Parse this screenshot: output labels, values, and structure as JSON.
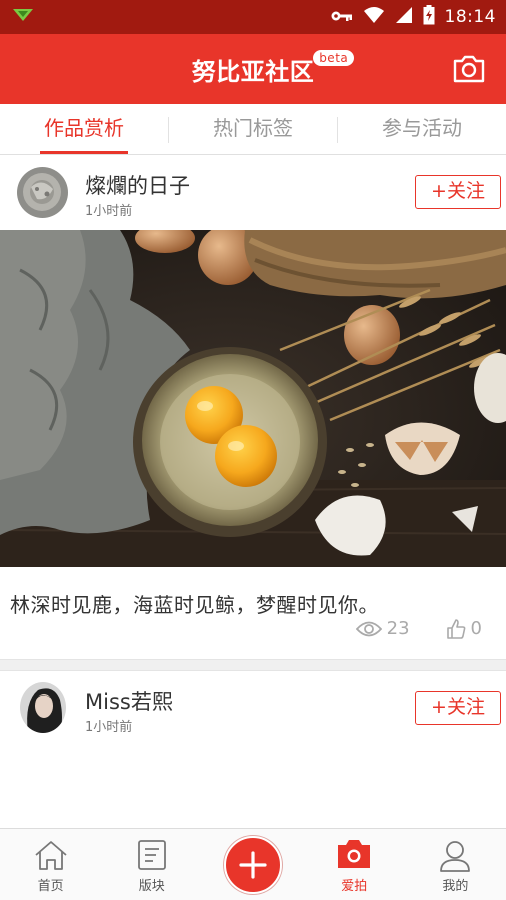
{
  "status_bar": {
    "time": "18:14"
  },
  "app_bar": {
    "title": "努比亚社区",
    "badge": "beta"
  },
  "tabs": [
    {
      "label": "作品赏析",
      "active": true
    },
    {
      "label": "热门标签",
      "active": false
    },
    {
      "label": "参与活动",
      "active": false
    }
  ],
  "posts": [
    {
      "author": "燦爛的日子",
      "time": "1小时前",
      "follow_label": "+关注",
      "caption": "林深时见鹿，海蓝时见鲸，梦醒时见你。",
      "views": "23",
      "likes": "0"
    },
    {
      "author": "Miss若熙",
      "time": "1小时前",
      "follow_label": "+关注"
    }
  ],
  "bottom_nav": {
    "items": [
      {
        "label": "首页",
        "icon": "home-icon"
      },
      {
        "label": "版块",
        "icon": "board-icon"
      },
      {
        "label": "",
        "icon": "plus-icon"
      },
      {
        "label": "爱拍",
        "icon": "camera-icon",
        "active": true
      },
      {
        "label": "我的",
        "icon": "profile-icon"
      }
    ]
  },
  "colors": {
    "accent": "#e8352a",
    "status_bar": "#a11a10"
  }
}
